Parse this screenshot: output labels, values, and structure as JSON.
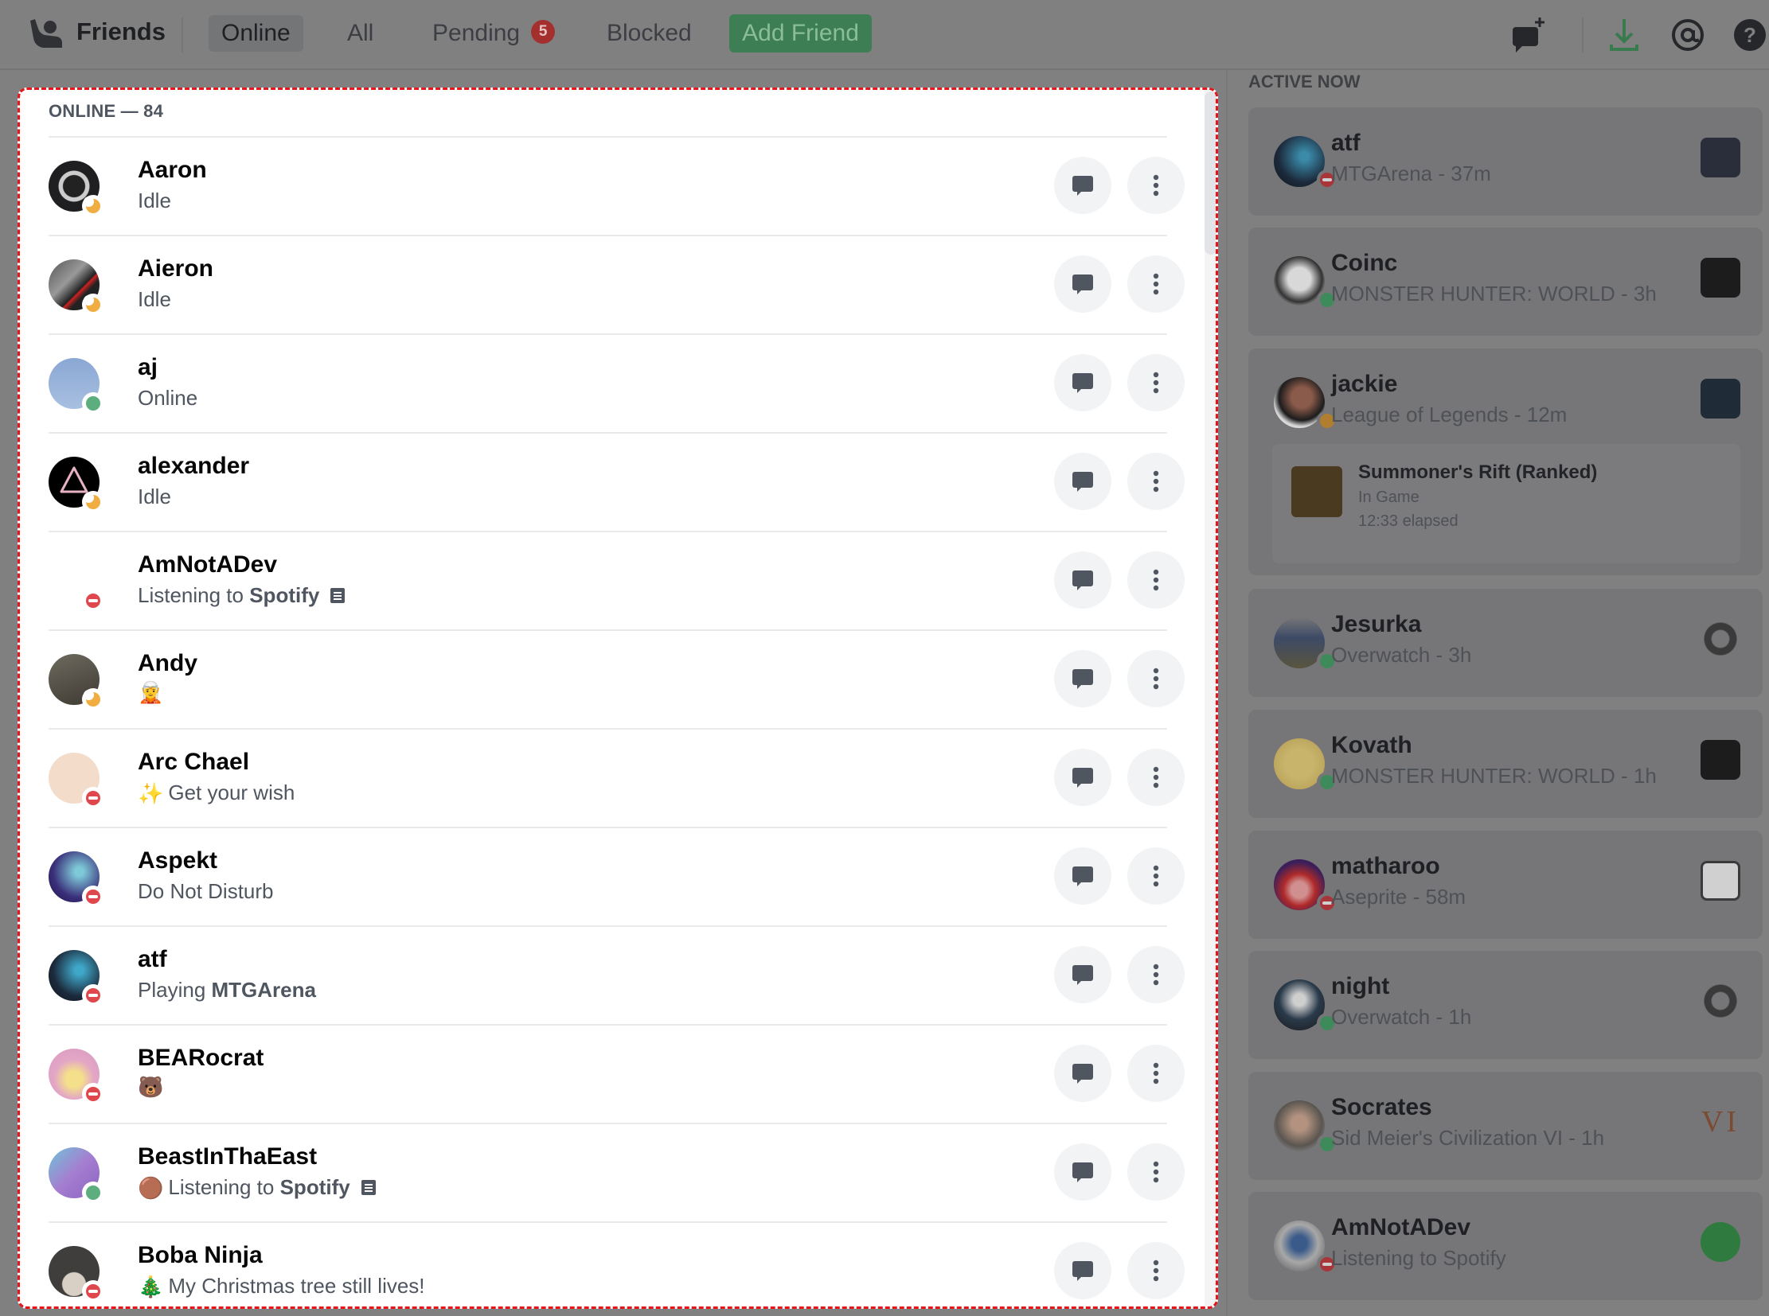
{
  "header": {
    "title": "Friends",
    "tabs": [
      {
        "label": "Online",
        "active": true
      },
      {
        "label": "All",
        "active": false
      },
      {
        "label": "Pending",
        "active": false,
        "badge": "5"
      },
      {
        "label": "Blocked",
        "active": false
      }
    ],
    "add_friend_label": "Add Friend",
    "icons": [
      "new-group-dm-icon",
      "download-icon",
      "mentions-icon",
      "help-icon"
    ]
  },
  "friends": {
    "section_title": "ONLINE — 84",
    "rows": [
      {
        "name": "Aaron",
        "status": "idle",
        "sub": "Idle"
      },
      {
        "name": "Aieron",
        "status": "idle",
        "sub": "Idle"
      },
      {
        "name": "aj",
        "status": "online",
        "sub": "Online"
      },
      {
        "name": "alexander",
        "status": "idle",
        "sub": "Idle"
      },
      {
        "name": "AmNotADev",
        "status": "dnd",
        "sub_prefix": "Listening to ",
        "sub_strong": "Spotify",
        "has_doc_icon": true
      },
      {
        "name": "Andy",
        "status": "idle",
        "emoji": "🧝",
        "sub": ""
      },
      {
        "name": "Arc Chael",
        "status": "dnd",
        "emoji": "✨",
        "sub": "Get your wish"
      },
      {
        "name": "Aspekt",
        "status": "dnd",
        "sub": "Do Not Disturb"
      },
      {
        "name": "atf",
        "status": "dnd",
        "sub_prefix": "Playing ",
        "sub_strong": "MTGArena"
      },
      {
        "name": "BEARocrat",
        "status": "dnd",
        "emoji": "🐻",
        "sub": ""
      },
      {
        "name": "BeastInThaEast",
        "status": "online",
        "emoji": "🟤",
        "sub_prefix": "Listening to ",
        "sub_strong": "Spotify",
        "has_doc_icon": true
      },
      {
        "name": "Boba Ninja",
        "status": "dnd",
        "emoji": "🎄",
        "sub": "My Christmas tree still lives!"
      }
    ],
    "actions": {
      "message": "message-icon",
      "more": "more-vertical-icon"
    }
  },
  "active_now": {
    "title": "ACTIVE NOW",
    "cards": [
      {
        "name": "atf",
        "status": "dnd",
        "activity": "MTGArena - 37m",
        "game_icon": "mtgarena"
      },
      {
        "name": "Coinc",
        "status": "online",
        "activity": "MONSTER HUNTER: WORLD - 3h",
        "game_icon": "monster-hunter"
      },
      {
        "name": "jackie",
        "status": "idle",
        "activity": "League of Legends - 12m",
        "game_icon": "league-of-legends",
        "rich": {
          "title": "Summoner's Rift (Ranked)",
          "state": "In Game",
          "elapsed": "12:33 elapsed"
        }
      },
      {
        "name": "Jesurka",
        "status": "online",
        "activity": "Overwatch - 3h",
        "game_icon": "overwatch"
      },
      {
        "name": "Kovath",
        "status": "online",
        "activity": "MONSTER HUNTER: WORLD - 1h",
        "game_icon": "monster-hunter"
      },
      {
        "name": "matharoo",
        "status": "dnd",
        "activity": "Aseprite - 58m",
        "game_icon": "aseprite"
      },
      {
        "name": "night",
        "status": "online",
        "activity": "Overwatch - 1h",
        "game_icon": "overwatch"
      },
      {
        "name": "Socrates",
        "status": "online",
        "activity": "Sid Meier's Civilization VI - 1h",
        "game_icon": "civilization-vi",
        "game_icon_text": "VI"
      },
      {
        "name": "AmNotADev",
        "status": "dnd",
        "activity": "Listening to Spotify",
        "game_icon": "spotify"
      }
    ]
  },
  "colors": {
    "accent_green": "#3d7e55",
    "badge_red": "#a3302f",
    "status_online": "#5dae7f",
    "status_idle": "#f0ad41",
    "status_dnd": "#e0474c",
    "highlight_border": "#e8141a"
  }
}
